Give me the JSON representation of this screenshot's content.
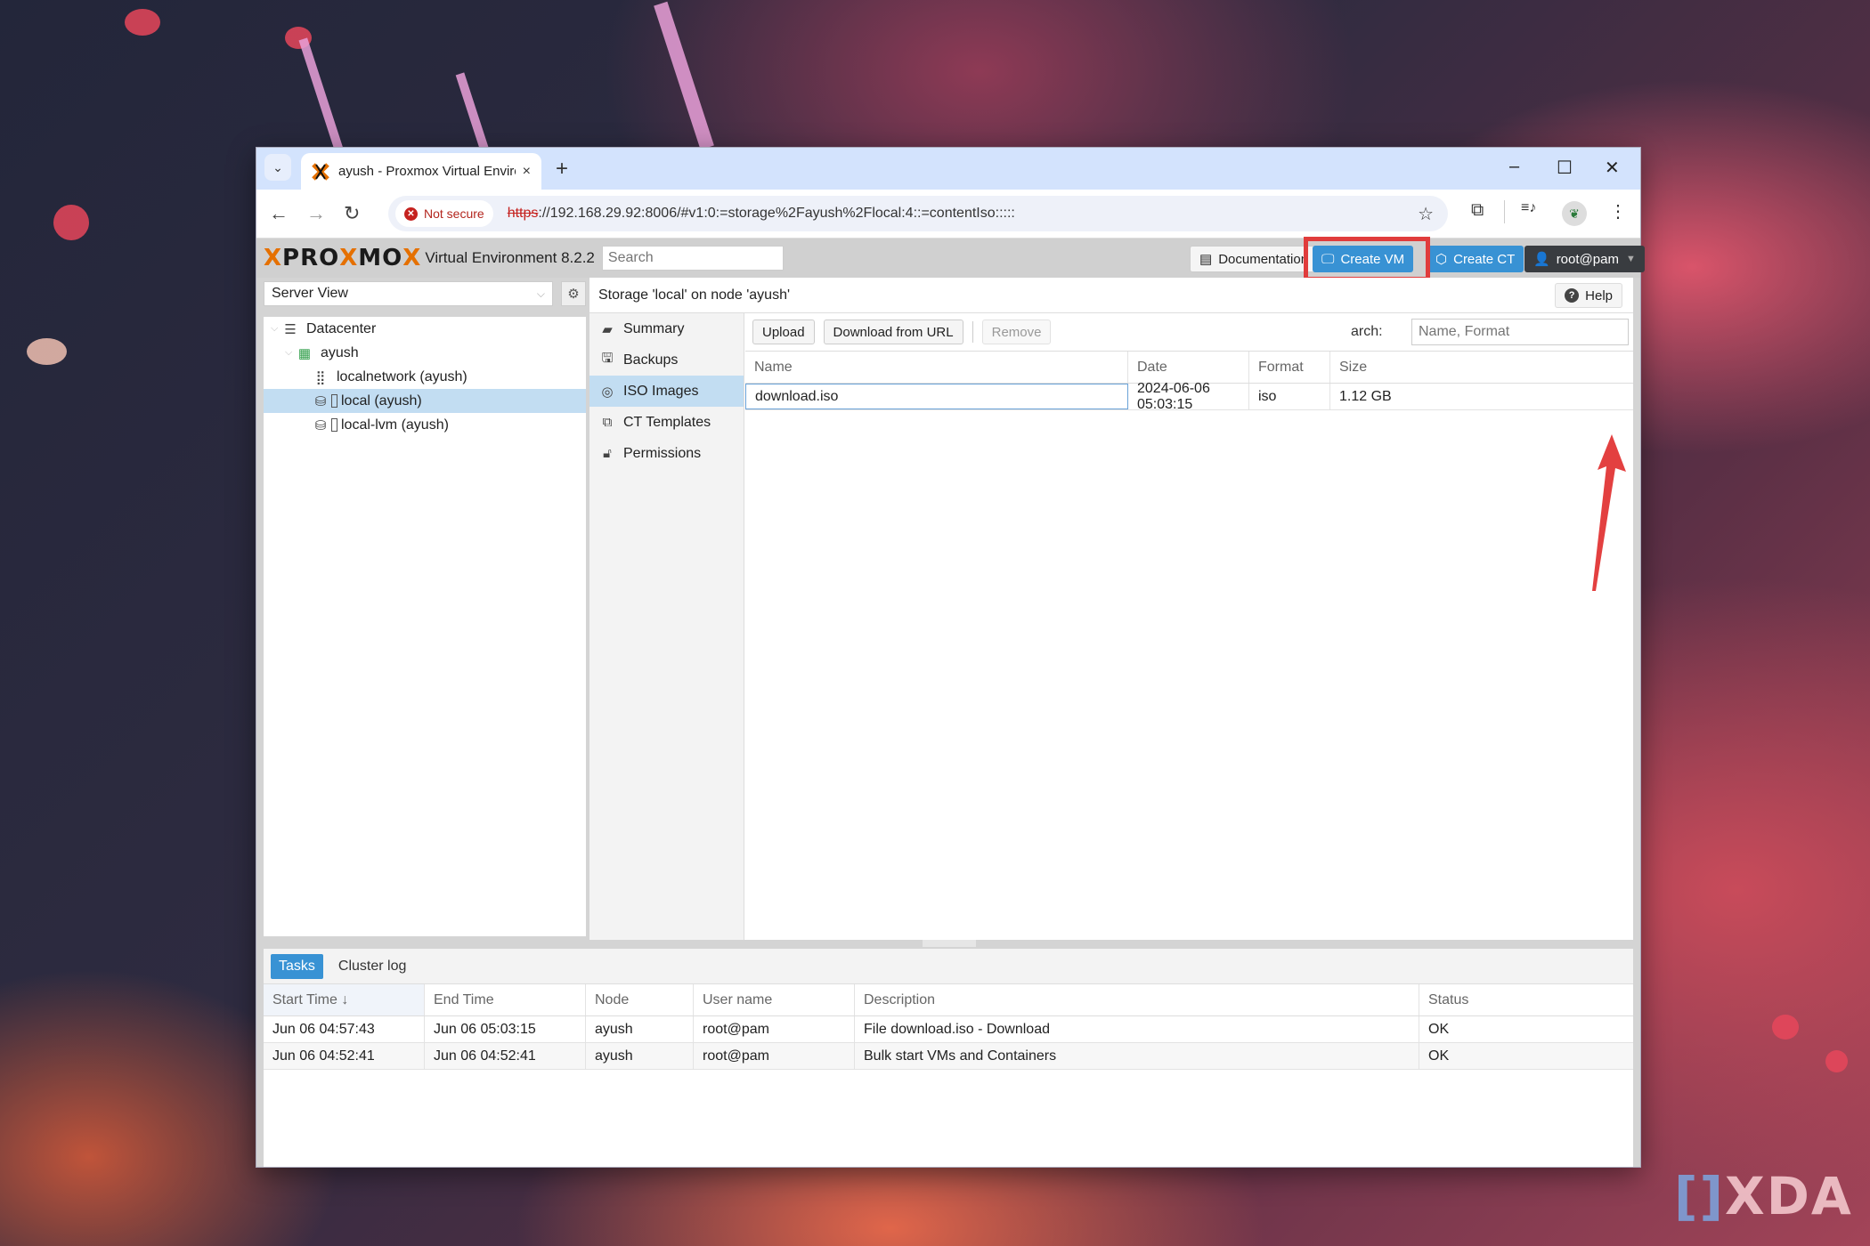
{
  "browser": {
    "tab_title": "ayush - Proxmox Virtual Enviror",
    "tab_close": "×",
    "new_tab": "+",
    "tab_list": "⌄",
    "security_label": "Not secure",
    "url_scheme": "https",
    "url_rest": "://192.168.29.92:8006/#v1:0:=storage%2Fayush%2Flocal:4::=contentIso:::::",
    "window_controls": {
      "minimize": "–",
      "maximize": "☐",
      "close": "✕"
    },
    "nav": {
      "back": "←",
      "forward": "→",
      "reload": "↻"
    },
    "icons": {
      "bookmark": "☆",
      "extensions": "⧉",
      "media": "≡♪",
      "menu": "⋮"
    }
  },
  "pve": {
    "logo_x1": "X",
    "logo_pro": "PRO",
    "logo_x2": "X",
    "logo_mo": "MO",
    "logo_x3": "X",
    "version": "Virtual Environment 8.2.2",
    "search_placeholder": "Search",
    "header_buttons": {
      "documentation": "Documentation",
      "create_vm": "Create VM",
      "create_ct": "Create CT",
      "user": "root@pam"
    },
    "view_selector": "Server View",
    "tree": [
      {
        "label": "Datacenter",
        "icon": "datacenter-icon",
        "level": 0
      },
      {
        "label": "ayush",
        "icon": "node-icon",
        "level": 1
      },
      {
        "label": "localnetwork (ayush)",
        "icon": "network-icon",
        "level": 2
      },
      {
        "label": "local (ayush)",
        "icon": "storage-icon",
        "level": 2,
        "selected": true
      },
      {
        "label": "local-lvm (ayush)",
        "icon": "storage-icon",
        "level": 2
      }
    ],
    "content_title": "Storage 'local' on node 'ayush'",
    "help": "Help",
    "subnav": [
      {
        "label": "Summary",
        "icon": "book-icon"
      },
      {
        "label": "Backups",
        "icon": "floppy-icon"
      },
      {
        "label": "ISO Images",
        "icon": "disc-icon",
        "selected": true
      },
      {
        "label": "CT Templates",
        "icon": "template-icon"
      },
      {
        "label": "Permissions",
        "icon": "unlock-icon"
      }
    ],
    "toolbar": {
      "upload": "Upload",
      "download_url": "Download from URL",
      "remove": "Remove",
      "search_label": "arch:",
      "search_placeholder": "Name, Format"
    },
    "iso_columns": [
      "Name",
      "Date",
      "Format",
      "Size"
    ],
    "iso_rows": [
      {
        "name": "download.iso",
        "date": "2024-06-06 05:03:15",
        "format": "iso",
        "size": "1.12 GB"
      }
    ],
    "task_tabs": [
      "Tasks",
      "Cluster log"
    ],
    "task_columns": [
      "Start Time ↓",
      "End Time",
      "Node",
      "User name",
      "Description",
      "Status"
    ],
    "task_rows": [
      {
        "start": "Jun 06 04:57:43",
        "end": "Jun 06 05:03:15",
        "node": "ayush",
        "user": "root@pam",
        "desc": "File download.iso - Download",
        "status": "OK"
      },
      {
        "start": "Jun 06 04:52:41",
        "end": "Jun 06 04:52:41",
        "node": "ayush",
        "user": "root@pam",
        "desc": "Bulk start VMs and Containers",
        "status": "OK"
      }
    ]
  },
  "colors": {
    "accent": "#3892d4",
    "highlight_box": "#e03c3c",
    "selection": "#c2ddf2",
    "proxmox_orange": "#e57000"
  },
  "watermark": {
    "bracket": "[]",
    "text": "XDA"
  }
}
